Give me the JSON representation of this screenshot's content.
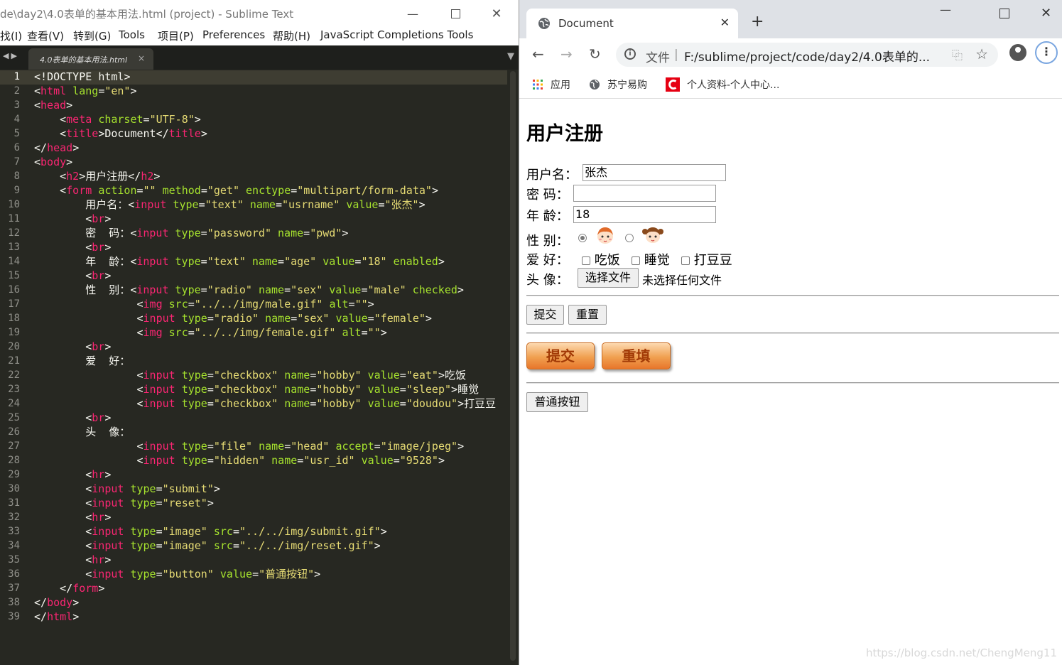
{
  "sublime": {
    "title": "de\\day2\\4.0表单的基本用法.html (project) - Sublime Text",
    "menu": [
      "找(I)",
      "查看(V)",
      "转到(G)",
      "Tools",
      "项目(P)",
      "Preferences",
      "帮助(H)",
      "JavaScript Completions Tools"
    ],
    "tab_name": "4.0表单的基本用法.html",
    "current_line": 1,
    "code": [
      "<!DOCTYPE html>",
      "<html lang=\"en\">",
      "<head>",
      "    <meta charset=\"UTF-8\">",
      "    <title>Document</title>",
      "</head>",
      "<body>",
      "    <h2>用户注册</h2>",
      "    <form action=\"\" method=\"get\" enctype=\"multipart/form-data\">",
      "        用户名：<input type=\"text\" name=\"usrname\" value=\"张杰\">",
      "        <br>",
      "        密  码：<input type=\"password\" name=\"pwd\">",
      "        <br>",
      "        年  龄：<input type=\"text\" name=\"age\" value=\"18\" enabled>",
      "        <br>",
      "        性  别：<input type=\"radio\" name=\"sex\" value=\"male\" checked>",
      "                <img src=\"../../img/male.gif\" alt=\"\">",
      "                <input type=\"radio\" name=\"sex\" value=\"female\">",
      "                <img src=\"../../img/female.gif\" alt=\"\">",
      "        <br>",
      "        爱  好：",
      "                <input type=\"checkbox\" name=\"hobby\" value=\"eat\">吃饭",
      "                <input type=\"checkbox\" name=\"hobby\" value=\"sleep\">睡觉",
      "                <input type=\"checkbox\" name=\"hobby\" value=\"doudou\">打豆豆",
      "        <br>",
      "        头  像：",
      "                <input type=\"file\" name=\"head\" accept=\"image/jpeg\">",
      "                <input type=\"hidden\" name=\"usr_id\" value=\"9528\">",
      "        <hr>",
      "        <input type=\"submit\">",
      "        <input type=\"reset\">",
      "        <hr>",
      "        <input type=\"image\" src=\"../../img/submit.gif\">",
      "        <input type=\"image\" src=\"../../img/reset.gif\">",
      "        <hr>",
      "        <input type=\"button\" value=\"普通按钮\">",
      "    </form>",
      "</body>",
      "</html>"
    ]
  },
  "chrome": {
    "tab_title": "Document",
    "omnibox": {
      "security_label": "文件",
      "url": "F:/sublime/project/code/day2/4.0表单的..."
    },
    "bookmarks": [
      {
        "label": "应用",
        "icon": "apps-grid-icon"
      },
      {
        "label": "苏宁易购",
        "icon": "globe-icon"
      },
      {
        "label": "个人资料-个人中心...",
        "icon": "csdn-icon"
      }
    ]
  },
  "page": {
    "heading": "用户注册",
    "username_label": "用户名：",
    "username_value": "张杰",
    "password_label": "密 码：",
    "password_value": "",
    "age_label": "年 龄：",
    "age_value": "18",
    "sex_label": "性 别：",
    "sex_options": [
      {
        "value": "male",
        "checked": true,
        "icon": "male-avatar-icon"
      },
      {
        "value": "female",
        "checked": false,
        "icon": "female-avatar-icon"
      }
    ],
    "hobby_label": "爱 好：",
    "hobbies": [
      "吃饭",
      "睡觉",
      "打豆豆"
    ],
    "avatar_label": "头 像：",
    "file_button": "选择文件",
    "file_status": "未选择任何文件",
    "submit_label": "提交",
    "reset_label": "重置",
    "image_submit": "提交",
    "image_reset": "重填",
    "plain_button": "普通按钮"
  },
  "watermark": "https://blog.csdn.net/ChengMeng11"
}
